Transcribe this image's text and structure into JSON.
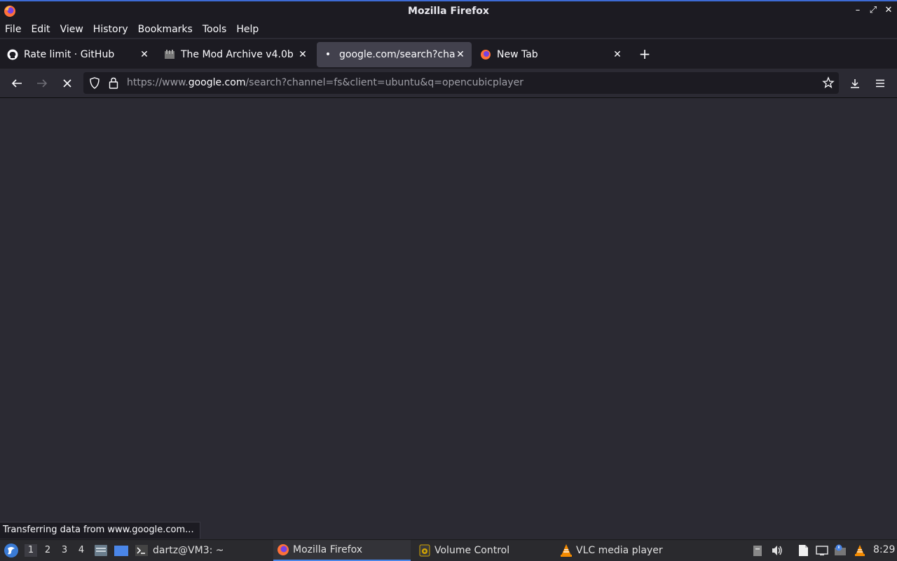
{
  "window": {
    "title": "Mozilla Firefox"
  },
  "menu": [
    "File",
    "Edit",
    "View",
    "History",
    "Bookmarks",
    "Tools",
    "Help"
  ],
  "tabs": [
    {
      "label": "Rate limit · GitHub",
      "icon": "github-icon"
    },
    {
      "label": "The Mod Archive v4.0b -",
      "icon": "modarchive-icon"
    },
    {
      "label": "google.com/search?chan",
      "icon": "loading-dot-icon"
    },
    {
      "label": "New Tab",
      "icon": "firefox-icon"
    }
  ],
  "urlbar": {
    "prefix": "https://www.",
    "host": "google.com",
    "path": "/search?channel=fs&client=ubuntu&q=opencubicplayer"
  },
  "status": "Transferring data from www.google.com...",
  "taskbar": {
    "workspaces": [
      "1",
      "2",
      "3",
      "4"
    ],
    "items": [
      {
        "label": "dartz@VM3: ~",
        "icon": "terminal-icon"
      },
      {
        "label": "Mozilla Firefox",
        "icon": "firefox-icon"
      },
      {
        "label": "Volume Control",
        "icon": "speaker-icon"
      },
      {
        "label": "VLC media player",
        "icon": "vlc-icon"
      }
    ],
    "clock": "8:29"
  },
  "colors": {
    "accent": "#4a86e8",
    "chrome": "#1c1b22",
    "content": "#2b2a33"
  }
}
